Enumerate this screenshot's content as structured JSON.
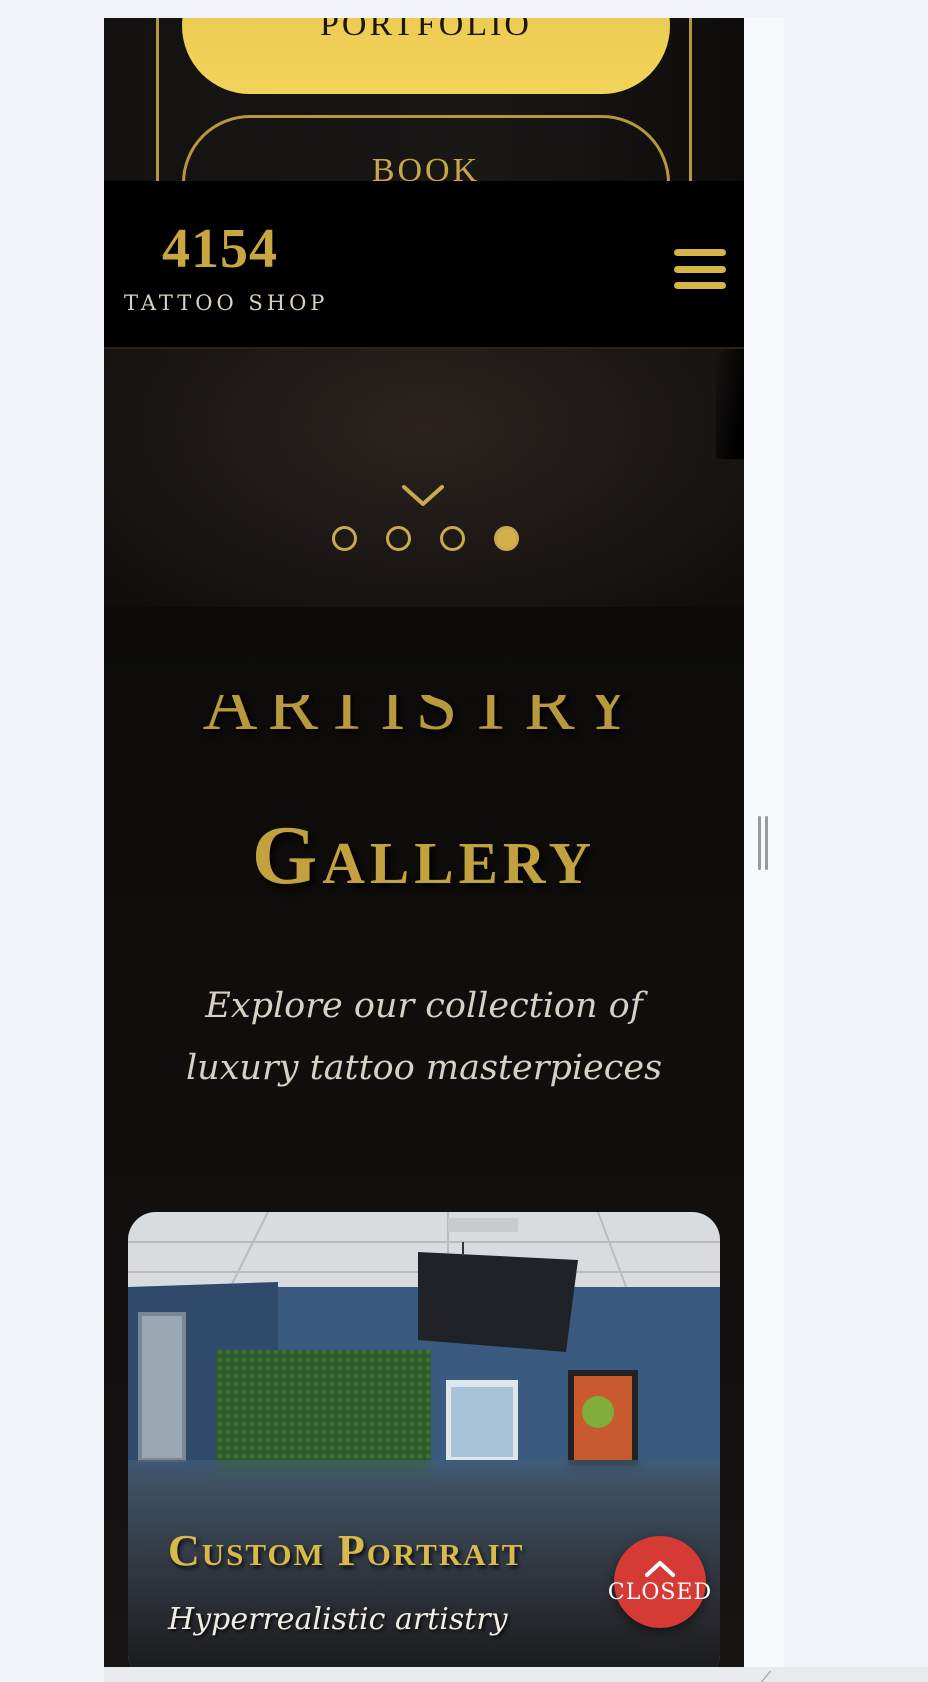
{
  "menu": {
    "portfolio_label": "Portfolio",
    "book_label": "Book"
  },
  "header": {
    "logo_number": "4154",
    "logo_subtitle": "TATTOO SHOP",
    "menu_icon": "hamburger-menu-icon"
  },
  "hero": {
    "scroll_icon": "chevron-down-icon",
    "slides": [
      "slide-1",
      "slide-2",
      "slide-3",
      "slide-4"
    ],
    "active_slide_index": 3
  },
  "gallery": {
    "kicker": "Artistry",
    "title": "Gallery",
    "subtitle": "Explore our collection of luxury tattoo masterpieces",
    "cards": [
      {
        "title": "Custom Portrait",
        "description": "Hyperrealistic artistry"
      }
    ]
  },
  "status_button": {
    "icon": "chevron-up-icon",
    "label": "CLOSED"
  },
  "colors": {
    "gold": "#c9a63f",
    "gold_bright": "#f3d45a",
    "background": "#0b0a09",
    "status_red": "#d63a34"
  }
}
